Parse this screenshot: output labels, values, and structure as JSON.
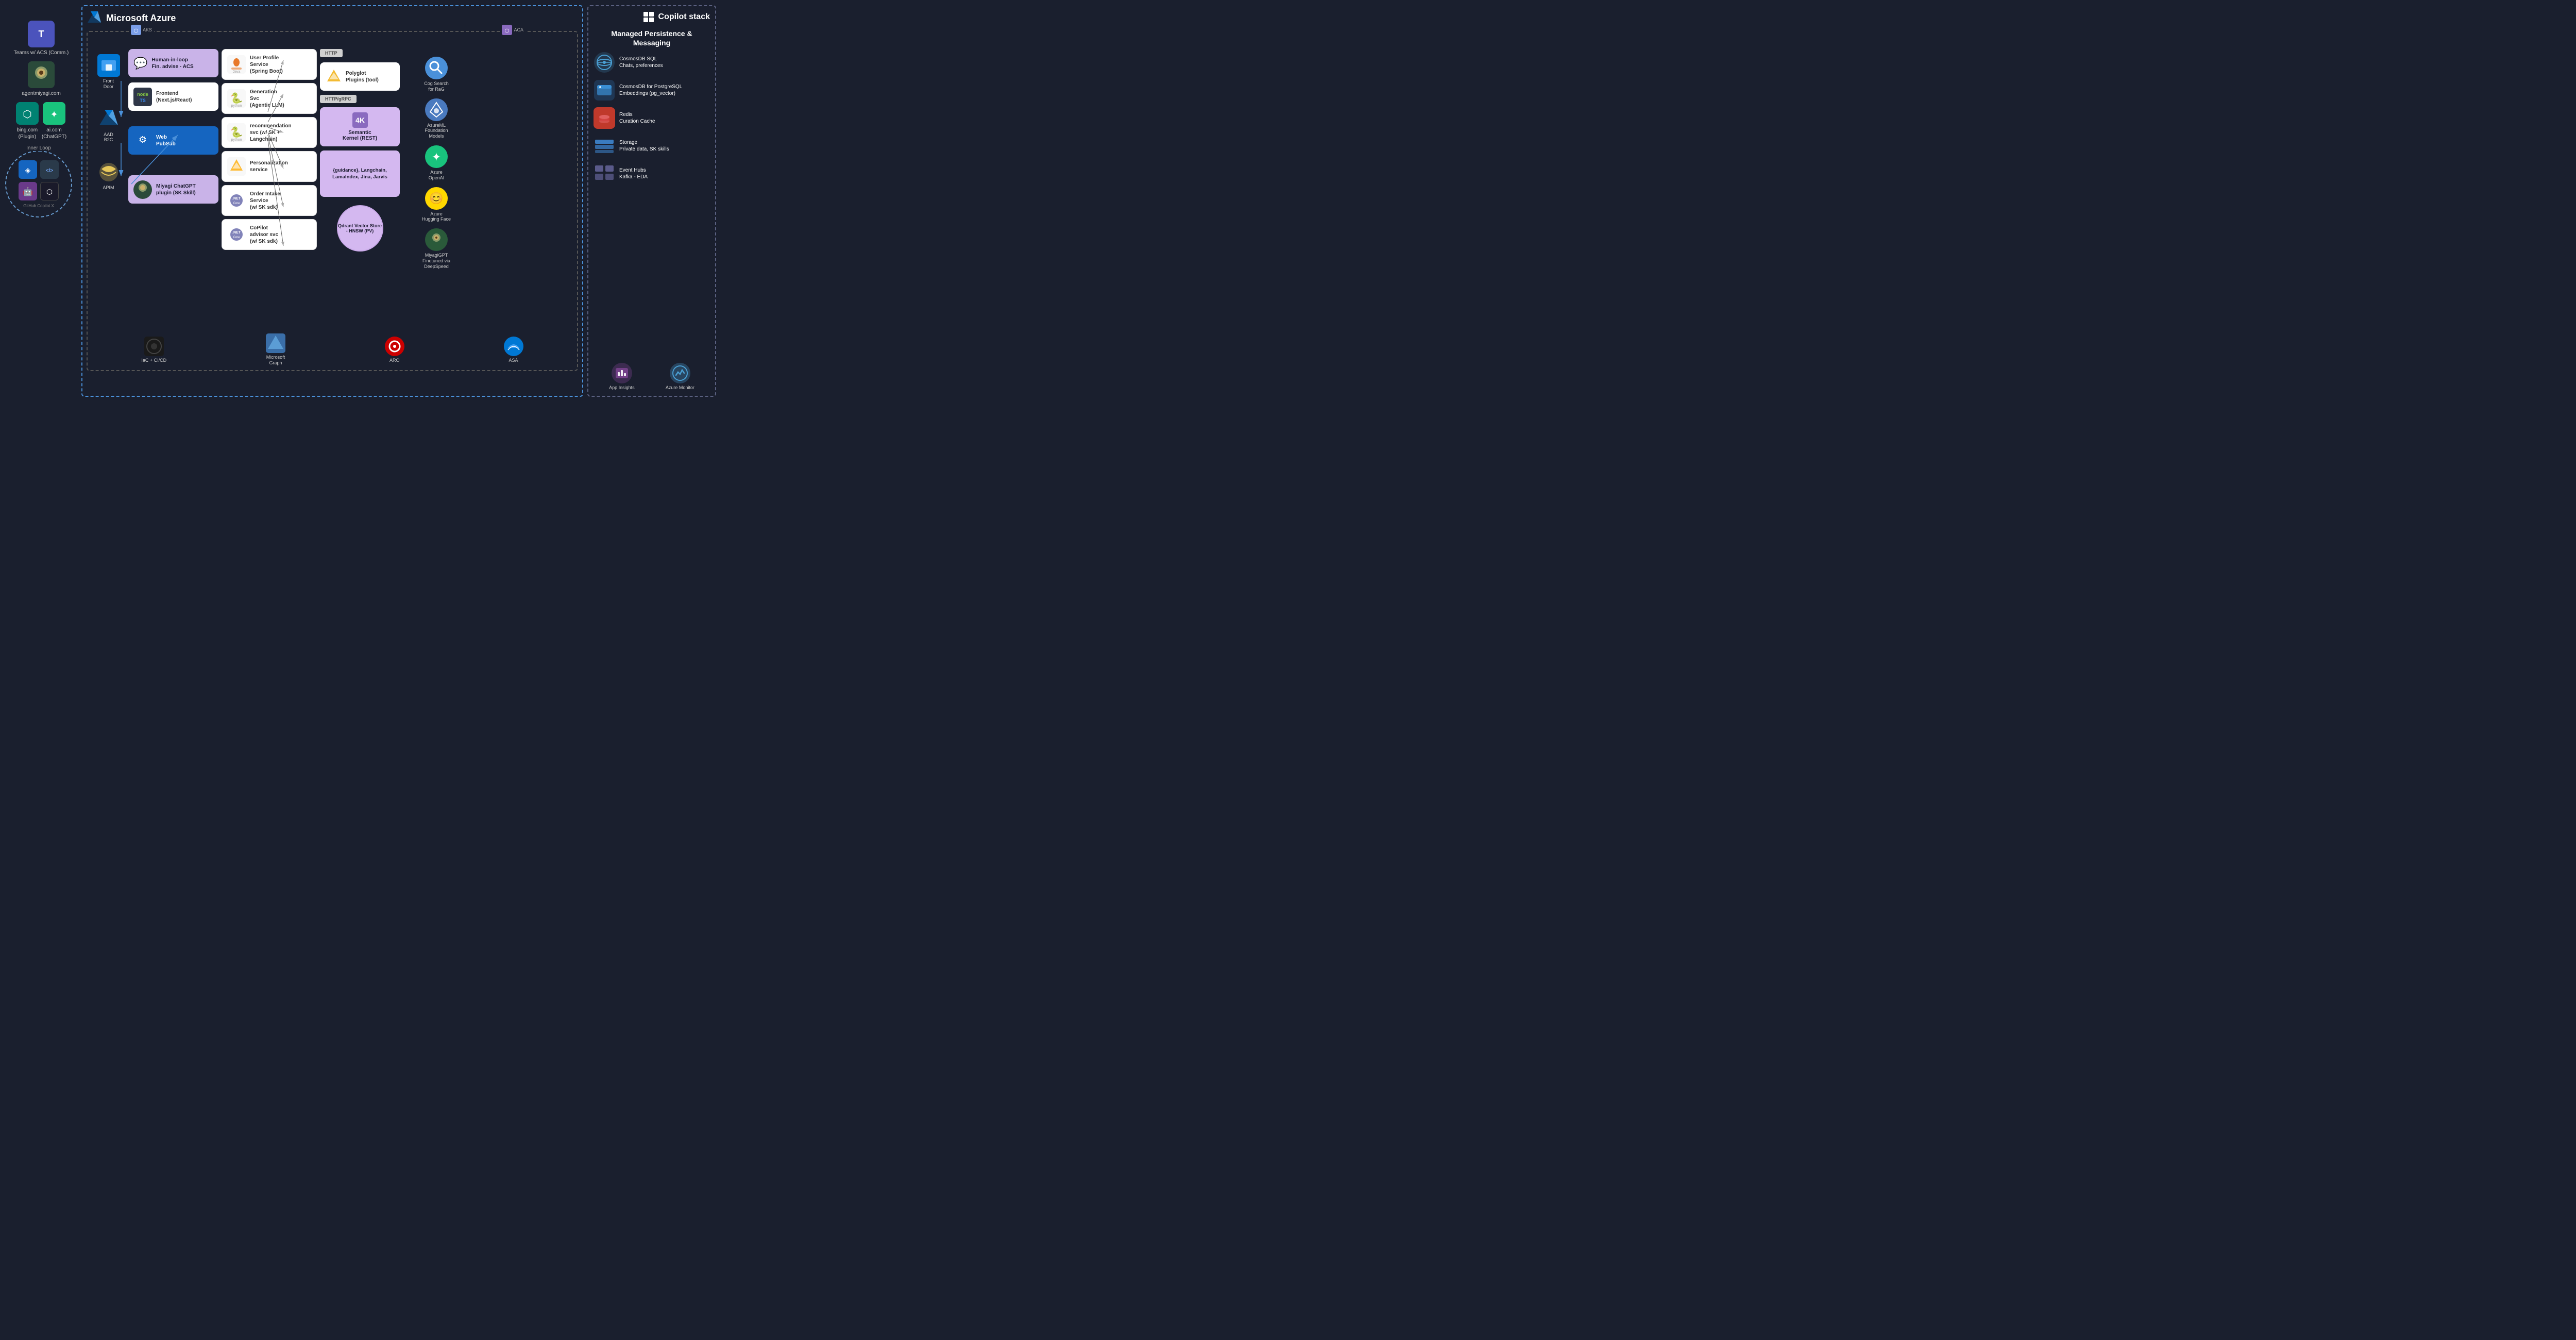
{
  "header": {
    "azure_logo": "⬡",
    "azure_title": "Microsoft Azure",
    "copilot_title": "Copilot stack",
    "copilot_icon": "⊞"
  },
  "left_panel": {
    "clients": [
      {
        "id": "teams",
        "icon": "T",
        "label": "Teams w/\nACS (Comm.)",
        "bg": "#4b53bc"
      },
      {
        "id": "agentmiyagi",
        "icon": "🌸",
        "label": "agentmiyagi.com",
        "bg": "#2a4a3a"
      },
      {
        "id": "bing",
        "icon": "⬡",
        "label": "bing.com\n(Plugin)",
        "bg": "#008272"
      },
      {
        "id": "aicum",
        "icon": "✦",
        "label": "ai.com\n(ChatGPT)",
        "bg": "#19c37d"
      }
    ],
    "inner_loop_label": "Inner Loop",
    "inner_loop_icons": [
      {
        "id": "vscode",
        "icon": "◈",
        "bg": "#1565c0",
        "label": "VS Code"
      },
      {
        "id": "dev",
        "icon": "</>",
        "bg": "#2a3a4a",
        "label": "Dev"
      },
      {
        "id": "copilot",
        "icon": "🤖",
        "bg": "#6a3a8a",
        "label": "Copilot"
      },
      {
        "id": "github",
        "icon": "⬡",
        "bg": "#1a1a1a",
        "label": "GitHub Copilot X"
      }
    ]
  },
  "entry_nodes": [
    {
      "id": "front-door",
      "icon": "🔷",
      "label": "Front\nDoor",
      "color": "#0089d6"
    },
    {
      "id": "aad-b2c",
      "icon": "◆",
      "label": "AAD\nB2C",
      "color": "#0078d4"
    },
    {
      "id": "apim",
      "icon": "☁",
      "label": "APIM",
      "color": "#f0c040"
    }
  ],
  "infra": [
    {
      "id": "aks",
      "icon": "⬡",
      "label": "AKS",
      "color": "#7b9ee8"
    },
    {
      "id": "aca",
      "icon": "⬡",
      "label": "ACA",
      "color": "#8a6abf"
    }
  ],
  "middle_services": [
    {
      "id": "human-loop",
      "icon": "💬",
      "label": "Human-in-loop\nFin. advise - ACS",
      "bg": "purple"
    },
    {
      "id": "frontend",
      "icon": "⬡",
      "label": "Frontend\n(Next.js/React)",
      "bg": "white"
    },
    {
      "id": "web-pubsub",
      "icon": "⚙",
      "label": "Web\nPubSub",
      "bg": "blue"
    },
    {
      "id": "miyagi-plugin",
      "icon": "🌸",
      "label": "Miyagi ChatGPT\nplugin (SK Skill)",
      "bg": "purple"
    }
  ],
  "microservices": [
    {
      "id": "user-profile",
      "icon": "☕",
      "label": "User Profile\nService\n(Spring Boot)",
      "lang": "Java"
    },
    {
      "id": "generation",
      "icon": "🐍",
      "label": "Generation\nSvc\n(Agentic LLM)",
      "lang": "python"
    },
    {
      "id": "recommendation",
      "icon": "🐍",
      "label": "recommendation\nsvc (w/ SK +\nLangchain)",
      "lang": "python"
    },
    {
      "id": "personalization",
      "icon": "⚡",
      "label": "Personalization\nservice",
      "lang": ""
    },
    {
      "id": "order-intake",
      "icon": "⬡",
      "label": "Order Intake\nService\n(w/ SK sdk)",
      "lang": ".NET Core"
    },
    {
      "id": "copilot-advisor",
      "icon": "⬡",
      "label": "CoPilot\nadvisor svc\n(w/ SK sdk)",
      "lang": ".NET Core"
    }
  ],
  "semantic_kernel": {
    "polyglot": {
      "icon": "⚡",
      "label": "Polyglot\nPlugins (tool)"
    },
    "http_badge": "HTTP",
    "http_grpc_badge": "HTTP/gRPC",
    "sk_label": "Semantic\nKernel (REST)",
    "guidance_label": "{guidance},\nLangchain,\nLamaIndex,\nJina, Jarvis",
    "qdrant_label": "Qdrant Vector\nStore - HNSW\n(PV)"
  },
  "right_azure_services": [
    {
      "id": "cog-search",
      "icon": "🔍",
      "label": "Cog Search\nfor RaG",
      "color": "#4a90d9"
    },
    {
      "id": "azureml",
      "icon": "🔬",
      "label": "AzureML\nFoundation\nModels",
      "color": "#6a9fd8"
    },
    {
      "id": "azure-openai",
      "icon": "✦",
      "label": "Azure\nOpenAI",
      "color": "#19c37d"
    },
    {
      "id": "azure-hf",
      "icon": "😊",
      "label": "Azure\nHugging Face",
      "color": "#ffd700"
    },
    {
      "id": "miyagigpt",
      "icon": "🌸",
      "label": "MiyagiGPT\nFinetuned via\nDeepSpeed",
      "color": "#2a5a3a"
    }
  ],
  "copilot_stack": {
    "section_title": "Managed\nPersistence &\nMessaging",
    "items": [
      {
        "id": "cosmosdb-sql",
        "icon": "🌐",
        "label": "CosmosDB SQL\nChats, preferences",
        "color": "#4a9fd4"
      },
      {
        "id": "cosmosdb-pg",
        "icon": "🌐",
        "label": "CosmosDB for PostgreSQL\nEmbeddings (pg_vector)",
        "color": "#4a9fd4"
      },
      {
        "id": "redis",
        "icon": "🗄",
        "label": "Redis\nCuration Cache",
        "color": "#c0392b"
      },
      {
        "id": "storage",
        "icon": "📦",
        "label": "Storage\nPrivate data, SK skills",
        "color": "#3a7bbf"
      },
      {
        "id": "event-hubs",
        "icon": "⬛",
        "label": "Event Hubs\nKafka - EDA",
        "color": "#5a5a8a"
      }
    ],
    "bottom_items": [
      {
        "id": "app-insights",
        "icon": "📊",
        "label": "App Insights",
        "color": "#8a4a9f"
      },
      {
        "id": "azure-monitor",
        "icon": "🌐",
        "label": "Azure Monitor",
        "color": "#4a9fd4"
      }
    ]
  },
  "bottom_infra": [
    {
      "id": "iac-cicd",
      "icon": "⬡",
      "label": "IaC + CI/CD",
      "color": "#1a1a1a"
    },
    {
      "id": "microsoft-graph",
      "icon": "◈",
      "label": "Microsoft\nGraph",
      "color": "#3a6ea8"
    },
    {
      "id": "aro",
      "icon": "⭕",
      "label": "ARO",
      "color": "#cc0000"
    },
    {
      "id": "asa",
      "icon": "☁",
      "label": "ASA",
      "color": "#0078d4"
    }
  ]
}
